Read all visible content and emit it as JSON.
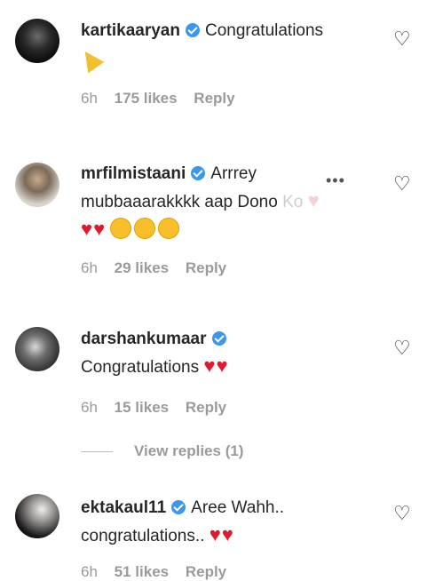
{
  "comments": [
    {
      "username": "kartikaaryan",
      "text": "Congratulations",
      "time": "6h",
      "likes": "175 likes",
      "reply": "Reply",
      "emoji": "party-popper-icon"
    },
    {
      "username": "mrfilmistaani",
      "text": "Arrrey mubbaaarakkkk aap Dono",
      "text_faded": "Ko",
      "time": "6h",
      "likes": "29 likes",
      "reply": "Reply",
      "emojis": [
        "heart-icon",
        "heart-icon",
        "hugging-face-icon",
        "hugging-face-icon",
        "hugging-face-icon"
      ]
    },
    {
      "username": "darshankumaar",
      "text": "Congratulations",
      "time": "6h",
      "likes": "15 likes",
      "reply": "Reply",
      "emojis": [
        "heart-icon",
        "heart-icon"
      ],
      "view_replies": "View replies (1)"
    },
    {
      "username": "ektakaul11",
      "text": "Aree Wahh.. congratulations..",
      "time": "6h",
      "likes": "51 likes",
      "reply": "Reply",
      "emojis": [
        "heart-icon",
        "heart-icon"
      ]
    }
  ],
  "colors": {
    "verified_badge": "#3897f0",
    "heart": "#e0192f",
    "meta_text": "#9a9a9a"
  }
}
